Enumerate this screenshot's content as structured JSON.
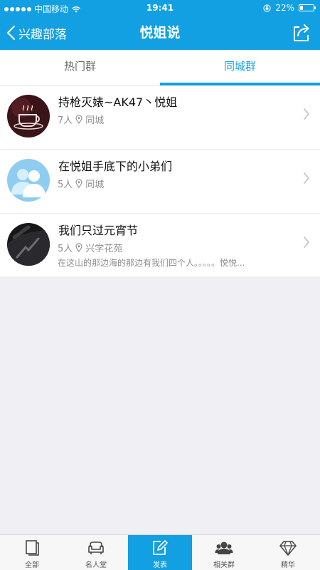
{
  "status": {
    "carrier": "中国移动",
    "time": "19:41",
    "battery": "22%",
    "battery_level": 0.22
  },
  "nav": {
    "back_label": "兴趣部落",
    "title": "悦姐说"
  },
  "tabs": [
    {
      "label": "热门群",
      "active": false
    },
    {
      "label": "同城群",
      "active": true
    }
  ],
  "groups": [
    {
      "name": "持枪灭婊~AK47丶悦姐",
      "members": "7人",
      "location": "同城",
      "description": ""
    },
    {
      "name": "在悦姐手底下的小弟们",
      "members": "5人",
      "location": "同城",
      "description": ""
    },
    {
      "name": "我们只过元宵节",
      "members": "5人",
      "location": "兴学花苑",
      "description": "在这山的那边海的那边有我们四个人。。。。。悦悦..."
    }
  ],
  "tabbar": [
    {
      "label": "全部",
      "icon": "document-icon",
      "active": false
    },
    {
      "label": "名人堂",
      "icon": "sofa-icon",
      "active": false
    },
    {
      "label": "发表",
      "icon": "compose-icon",
      "active": true
    },
    {
      "label": "相关群",
      "icon": "group-icon",
      "active": false
    },
    {
      "label": "精华",
      "icon": "diamond-icon",
      "active": false
    }
  ],
  "colors": {
    "accent": "#12a0e2",
    "background": "#efeff4"
  }
}
